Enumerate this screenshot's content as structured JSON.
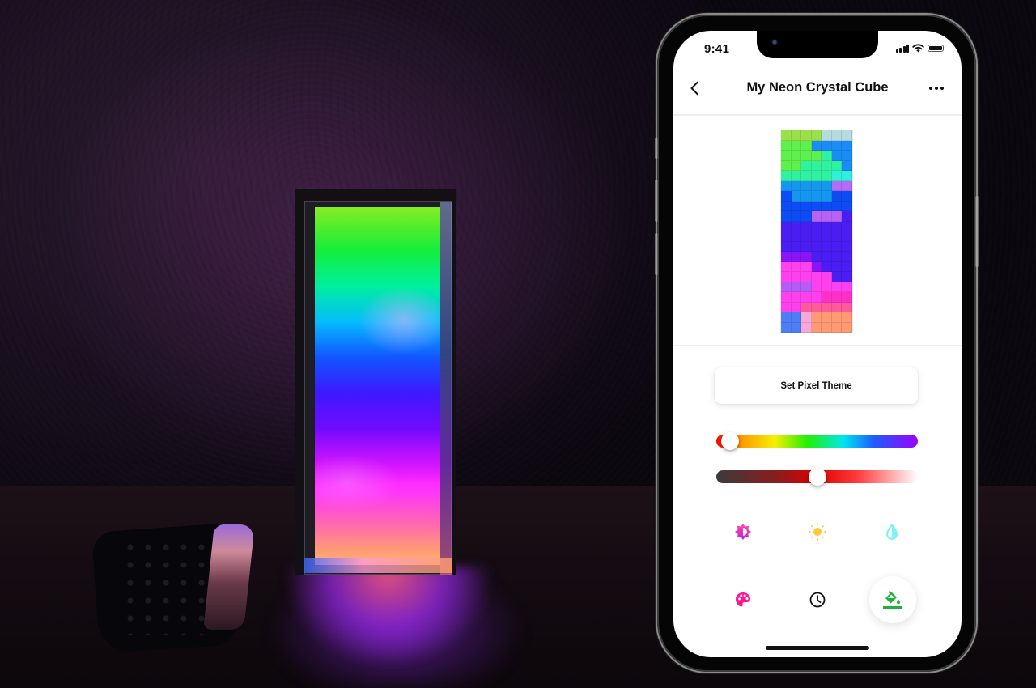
{
  "status_bar": {
    "time": "9:41",
    "signal_bars": 4,
    "wifi": true,
    "battery_level": 1.0
  },
  "header": {
    "title": "My Neon Crystal Cube",
    "back_icon": "chevron-left-icon",
    "more_icon": "more-horizontal-icon"
  },
  "pixel_grid": {
    "columns": 7,
    "rows": 20,
    "palette": {
      "L": "#9be04a",
      "T": "#b4dbe0",
      "G": "#5ef04c",
      "B": "#1a8cf5",
      "M": "#2ff2a0",
      "C": "#2ef0dc",
      "A": "#1597f0",
      "V": "#b56bf5",
      "D": "#0d4bf5",
      "P": "#b861f5",
      "I": "#4a1df2",
      "U": "#8a14f5",
      "K": "#ff40ee",
      "O": "#b45cf5",
      "H": "#ff30c8",
      "R": "#ff5a9a",
      "N": "#4d7ef5",
      "S": "#f7a8d8",
      "E": "#ff9a72"
    },
    "cells": [
      "LLLLTTT",
      "GGGBBBB",
      "GGGGMBB",
      "GGMMMMB",
      "MMMMMCC",
      "AAAAAVV",
      "DAAAADD",
      "DDDDDDD",
      "DDDPPPI",
      "IIIIIII",
      "IIIIIII",
      "IIIIIII",
      "UUUIIII",
      "KKKUIII",
      "KKKKKII",
      "OOOKKKK",
      "KKKKHHH",
      "KKRRRRR",
      "NNSEEEE",
      "NNSEEEE"
    ]
  },
  "theme_button": {
    "label": "Set Pixel Theme"
  },
  "sliders": {
    "hue": {
      "name": "Hue",
      "value": 0.07
    },
    "brightness": {
      "name": "Brightness",
      "value": 0.5
    }
  },
  "tools_row1": [
    {
      "icon": "contrast-icon",
      "color": "#e62fc8"
    },
    {
      "icon": "sun-icon",
      "color": "#ffc83a"
    },
    {
      "icon": "water-drop-icon",
      "color": "#7ef2f5"
    }
  ],
  "tools_row2": [
    {
      "icon": "palette-icon",
      "color": "#ff1493"
    },
    {
      "icon": "clock-icon",
      "color": "#111111"
    },
    {
      "icon": "paint-bucket-icon",
      "color": "#1bb33a",
      "active": true
    }
  ]
}
